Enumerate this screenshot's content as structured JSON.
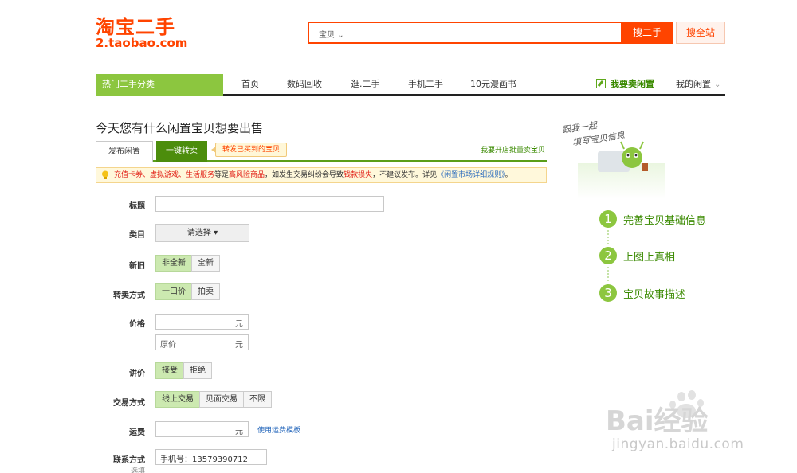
{
  "logo": {
    "main": "淘宝二手",
    "sub": "2.taobao.com"
  },
  "search": {
    "scope": "宝贝",
    "placeholder": "",
    "button": "搜二手",
    "button_all": "搜全站"
  },
  "nav": {
    "category": "热门二手分类",
    "items": [
      "首页",
      "数码回收",
      "逛.二手",
      "手机二手",
      "10元漫画书"
    ],
    "sell": "我要卖闲置",
    "mine": "我的闲置"
  },
  "page_title": "今天您有什么闲置宝贝想要出售",
  "tabs": {
    "publish": "发布闲置",
    "resell": "一键转卖",
    "tip": "转发已买到的宝贝",
    "bulk": "我要开店批量卖宝贝"
  },
  "notice": {
    "r1": "充值卡券、虚拟游戏、生活服务",
    "t1": "等是",
    "r2": "高风险商品",
    "t2": "，如发生交易纠纷会导致",
    "r3": "钱款损失",
    "t3": "，不建议发布。详见",
    "link": "《闲置市场详细规则》",
    "t4": "。"
  },
  "form": {
    "title_label": "标题",
    "category_label": "类目",
    "category_select": "请选择",
    "condition_label": "新旧",
    "condition_options": [
      "非全新",
      "全新"
    ],
    "sale_method_label": "转卖方式",
    "sale_method_options": [
      "一口价",
      "拍卖"
    ],
    "price_label": "价格",
    "price_unit": "元",
    "original_price_placeholder": "原价",
    "original_price_unit": "元",
    "bargain_label": "讲价",
    "bargain_options": [
      "接受",
      "拒绝"
    ],
    "trade_label": "交易方式",
    "trade_options": [
      "线上交易",
      "见面交易",
      "不限"
    ],
    "shipping_label": "运费",
    "shipping_unit": "元",
    "shipping_link": "使用运费模板",
    "contact_label": "联系方式",
    "contact_sub": "选填",
    "contact_value": "手机号：13579390712"
  },
  "right": {
    "handwriting_1": "跟我一起",
    "handwriting_2": "填写宝贝信息",
    "steps": [
      {
        "num": "1",
        "label": "完善宝贝基础信息"
      },
      {
        "num": "2",
        "label": "上图上真相"
      },
      {
        "num": "3",
        "label": "宝贝故事描述"
      }
    ]
  },
  "watermark": {
    "logo": "Bai经验",
    "url": "jingyan.baidu.com"
  },
  "colors": {
    "accent_orange": "#ff4400",
    "accent_green": "#8cc63f",
    "dark_green": "#4c8d0c"
  }
}
